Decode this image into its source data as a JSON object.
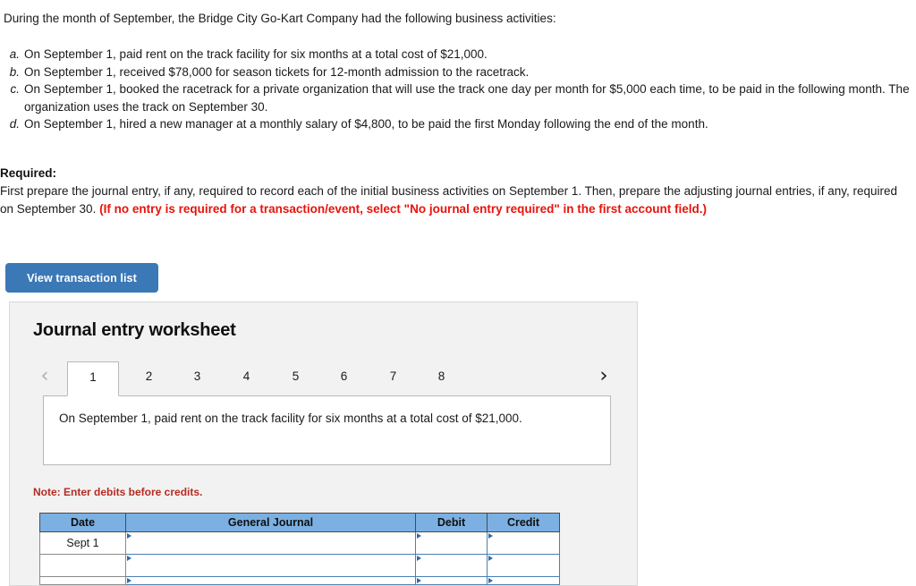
{
  "intro": "During the month of September, the Bridge City Go-Kart Company had the following business activities:",
  "activities": [
    {
      "letter": "a.",
      "text": "On September 1, paid rent on the track facility for six months at a total cost of $21,000."
    },
    {
      "letter": "b.",
      "text": "On September 1, received $78,000 for season tickets for 12-month admission to the racetrack."
    },
    {
      "letter": "c.",
      "text": "On September 1, booked the racetrack for a private organization that will use the track one day per month for $5,000 each time, to be paid in the following month. The organization uses the track on September 30."
    },
    {
      "letter": "d.",
      "text": "On September 1, hired a new manager at a monthly salary of $4,800, to be paid the first Monday following the end of the month."
    }
  ],
  "required": {
    "title": "Required:",
    "body_black": "First prepare the journal entry, if any, required to record each of the initial business activities on September 1. Then, prepare the adjusting journal entries, if any, required on September 30. ",
    "body_red": "(If no entry is required for a transaction/event, select \"No journal entry required\" in the first account field.)"
  },
  "buttons": {
    "view_transaction_list": "View transaction list"
  },
  "worksheet": {
    "title": "Journal entry worksheet",
    "prev_icon": "‹",
    "next_icon": "›",
    "tabs": [
      {
        "label": "1",
        "active": true
      },
      {
        "label": "2",
        "active": false
      },
      {
        "label": "3",
        "active": false
      },
      {
        "label": "4",
        "active": false
      },
      {
        "label": "5",
        "active": false
      },
      {
        "label": "6",
        "active": false
      },
      {
        "label": "7",
        "active": false
      },
      {
        "label": "8",
        "active": false
      }
    ],
    "description": "On September 1, paid rent on the track facility for six months at a total cost of $21,000.",
    "note": "Note: Enter debits before credits.",
    "table": {
      "headers": [
        "Date",
        "General Journal",
        "Debit",
        "Credit"
      ],
      "rows": [
        {
          "date": "Sept 1",
          "general_journal": "",
          "debit": "",
          "credit": ""
        },
        {
          "date": "",
          "general_journal": "",
          "debit": "",
          "credit": ""
        },
        {
          "date": "",
          "general_journal": "",
          "debit": "",
          "credit": ""
        }
      ]
    }
  },
  "colors": {
    "button_blue": "#3b78b6",
    "header_blue": "#7cb0e2",
    "cell_border_blue": "#4a7fb5",
    "required_red": "#e8130b",
    "note_red": "#b52b23",
    "panel_bg": "#f2f2f2"
  }
}
